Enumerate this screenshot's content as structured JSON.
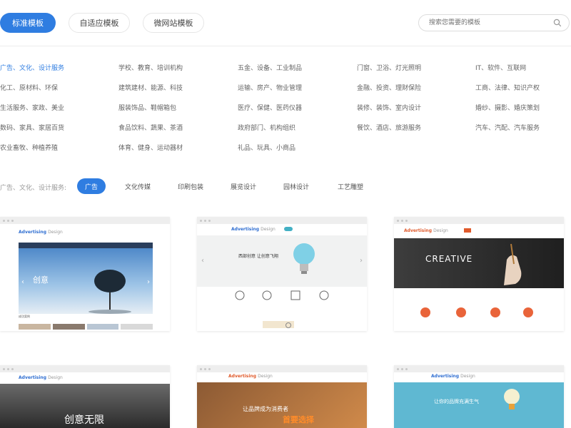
{
  "tabs": [
    {
      "label": "标准模板",
      "active": true
    },
    {
      "label": "自适应模板",
      "active": false
    },
    {
      "label": "微网站模板",
      "active": false
    }
  ],
  "search": {
    "placeholder": "搜索您需要的模板",
    "icon": "search-icon"
  },
  "categories": [
    [
      "广告、文化、设计服务",
      "学校、教育、培训机构",
      "五金、设备、工业制品",
      "门窗、卫浴、灯光照明",
      "IT、软件、互联网"
    ],
    [
      "化工、原材料、环保",
      "建筑建材、能源、科技",
      "运输、房产、物业管理",
      "金融、投资、理财保险",
      "工商、法律、知识产权"
    ],
    [
      "生活服务、家政、美业",
      "服装饰品、鞋帽箱包",
      "医疗、保健、医药仪器",
      "装修、装饰、室内设计",
      "婚纱、摄影、婚庆策划"
    ],
    [
      "数码、家具、家居百货",
      "食品饮料、蔬果、茶酒",
      "政府部门、机构组织",
      "餐饮、酒店、旅游服务",
      "汽车、汽配、汽车服务"
    ],
    [
      "农业畜牧、种植养殖",
      "体育、健身、运动器材",
      "礼品、玩具、小商品",
      "",
      ""
    ]
  ],
  "active_category": "广告、文化、设计服务",
  "subcategory": {
    "label": "广告、文化、设计服务:",
    "items": [
      "广告",
      "文化传媒",
      "印刷包装",
      "展览设计",
      "园林设计",
      "工艺雕塑"
    ],
    "active": "广告"
  },
  "templates": [
    {
      "logo": "Advertising",
      "logo_sub": "Design",
      "hero_text": "创意",
      "footer_text": "成功案例",
      "style": "sky"
    },
    {
      "logo": "Advertising",
      "logo_sub": "Design",
      "hero_text": "西部创意 让创意飞翔",
      "footer_text": "",
      "style": "bulb"
    },
    {
      "logo": "Advertising",
      "logo_sub": "Design",
      "hero_text": "CREATIVE",
      "footer_text": "",
      "style": "creative"
    },
    {
      "logo": "Advertising",
      "logo_sub": "Design",
      "hero_text": "创意无限",
      "footer_text": "",
      "style": "dark"
    },
    {
      "logo": "Advertising",
      "logo_sub": "Design",
      "hero_text": "让品牌成为消费者",
      "hero_text2": "首要选择",
      "footer_text": "",
      "style": "brown"
    },
    {
      "logo": "Advertising",
      "logo_sub": "Design",
      "hero_text": "让你的品牌充满生气",
      "footer_text": "",
      "style": "blue"
    }
  ],
  "colors": {
    "accent": "#2f7de1",
    "text": "#666666",
    "muted": "#999999"
  }
}
